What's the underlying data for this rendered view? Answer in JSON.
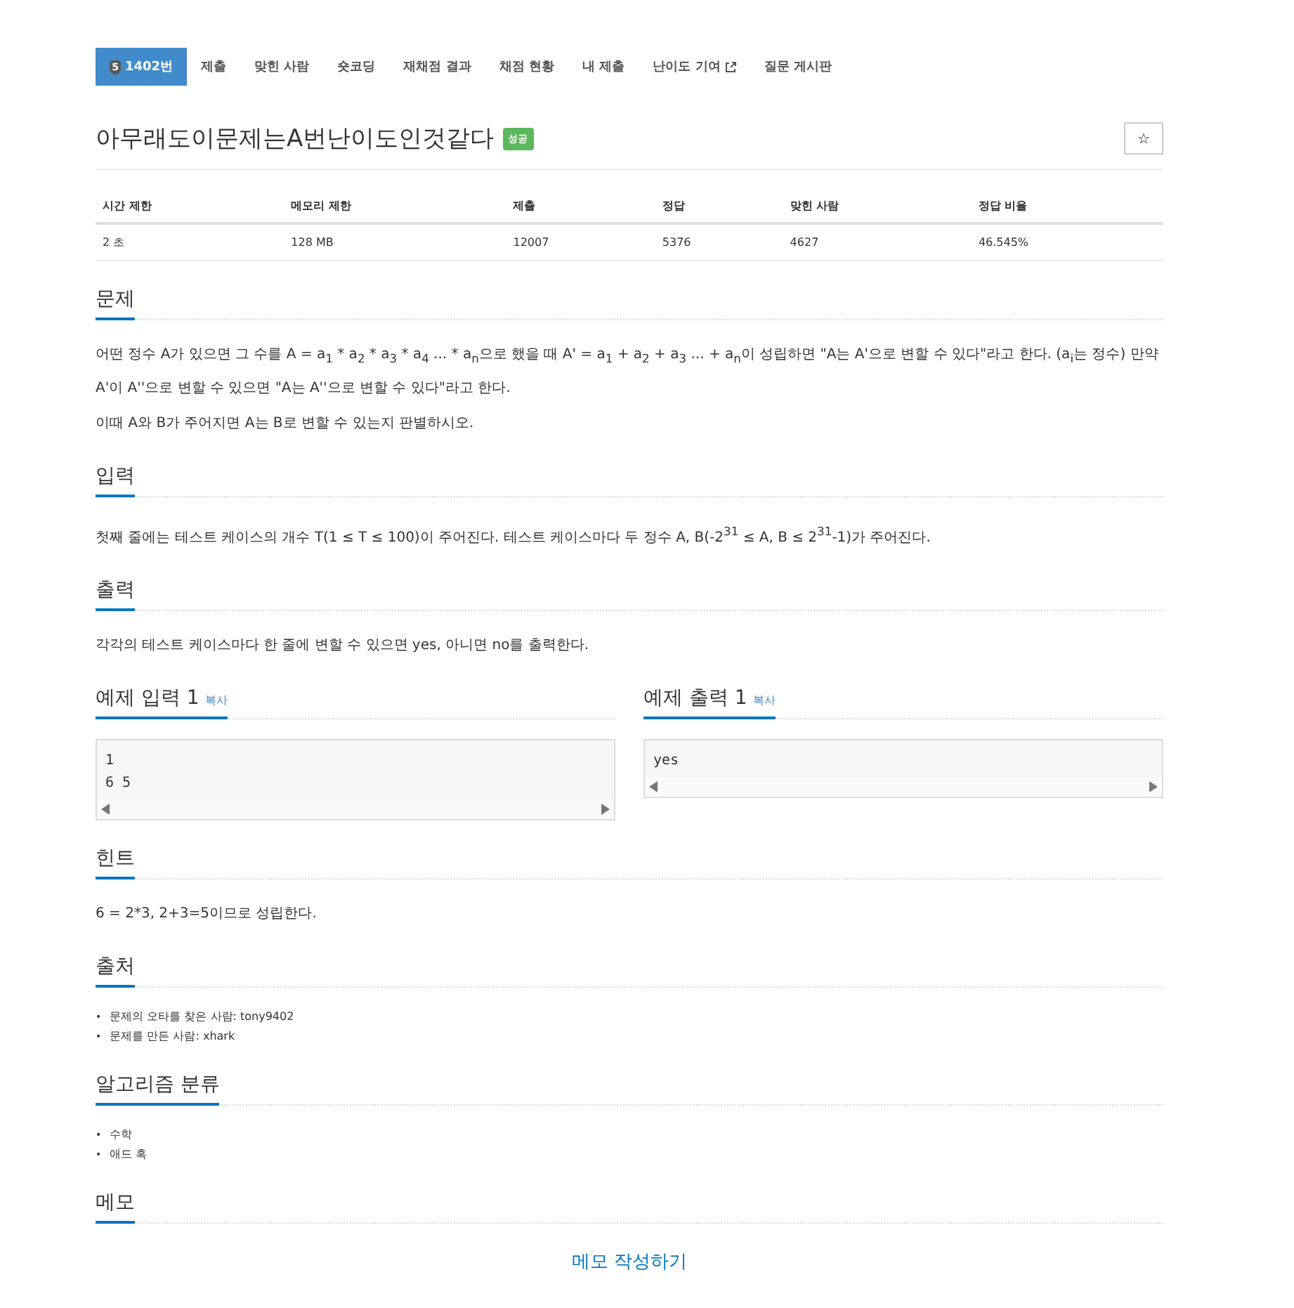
{
  "tabs": [
    {
      "label": "1402번",
      "tier": "5",
      "selected": true
    },
    {
      "label": "제출",
      "selected": false
    },
    {
      "label": "맞힌 사람",
      "selected": false
    },
    {
      "label": "숏코딩",
      "selected": false
    },
    {
      "label": "재채점 결과",
      "selected": false
    },
    {
      "label": "채점 현황",
      "selected": false
    },
    {
      "label": "내 제출",
      "selected": false
    },
    {
      "label": "난이도 기여",
      "external": true,
      "selected": false
    },
    {
      "label": "질문 게시판",
      "selected": false
    }
  ],
  "title": "아무래도이문제는A번난이도인것같다",
  "result_badge": "성공",
  "star_button": "☆",
  "info_table": {
    "columns": [
      "시간 제한",
      "메모리 제한",
      "제출",
      "정답",
      "맞힌 사람",
      "정답 비율"
    ],
    "rows": [
      [
        "2 초",
        "128 MB",
        "12007",
        "5376",
        "4627",
        "46.545%"
      ]
    ]
  },
  "sections": [
    {
      "kind": "text",
      "heading": "문제",
      "paragraphs": [
        "어떤 정수 A가 있으면 그 수를 A = a$_{1}$ * a$_{2}$ * a$_{3}$ * a$_{4}$ ... * a$_{n}$으로 했을 때 A' = a$_{1}$ + a$_{2}$ + a$_{3}$ ... + a$_{n}$이 성립하면 \"A는 A'으로 변할 수 있다\"라고 한다. (a$_{i}$는 정수) 만약 A'이 A''으로 변할 수 있으면 \"A는 A''으로 변할 수 있다\"라고 한다.",
        "이때 A와 B가 주어지면 A는 B로 변할 수 있는지 판별하시오."
      ]
    },
    {
      "kind": "text",
      "heading": "입력",
      "paragraphs": [
        "첫째 줄에는 테스트 케이스의 개수 T(1 ≤ T ≤ 100)이 주어진다. 테스트 케이스마다 두 정수 A, B(-2$^{31}$ ≤ A, B ≤ 2$^{31}$-1)가 주어진다."
      ]
    },
    {
      "kind": "text",
      "heading": "출력",
      "paragraphs": [
        "각각의 테스트 케이스마다 한 줄에 변할 수 있으면 yes, 아니면 no를 출력한다."
      ]
    },
    {
      "kind": "samples",
      "samples": [
        {
          "heading": "예제 입력 1",
          "copy": "복사",
          "lines": [
            "1",
            "6 5"
          ]
        },
        {
          "heading": "예제 출력 1",
          "copy": "복사",
          "lines": [
            "yes"
          ]
        }
      ]
    },
    {
      "kind": "text",
      "heading": "힌트",
      "paragraphs": [
        "6 = 2*3, 2+3=5이므로 성립한다."
      ]
    },
    {
      "kind": "list",
      "heading": "출처",
      "marker": "•",
      "items": [
        "문제의 오타를 찾은 사람: tony9402",
        "문제를 만든 사람: xhark"
      ]
    },
    {
      "kind": "list",
      "heading": "알고리즘 분류",
      "marker": "•",
      "items": [
        "수학",
        "애드 혹"
      ]
    },
    {
      "kind": "memo",
      "heading": "메모",
      "link": "메모 작성하기"
    }
  ]
}
